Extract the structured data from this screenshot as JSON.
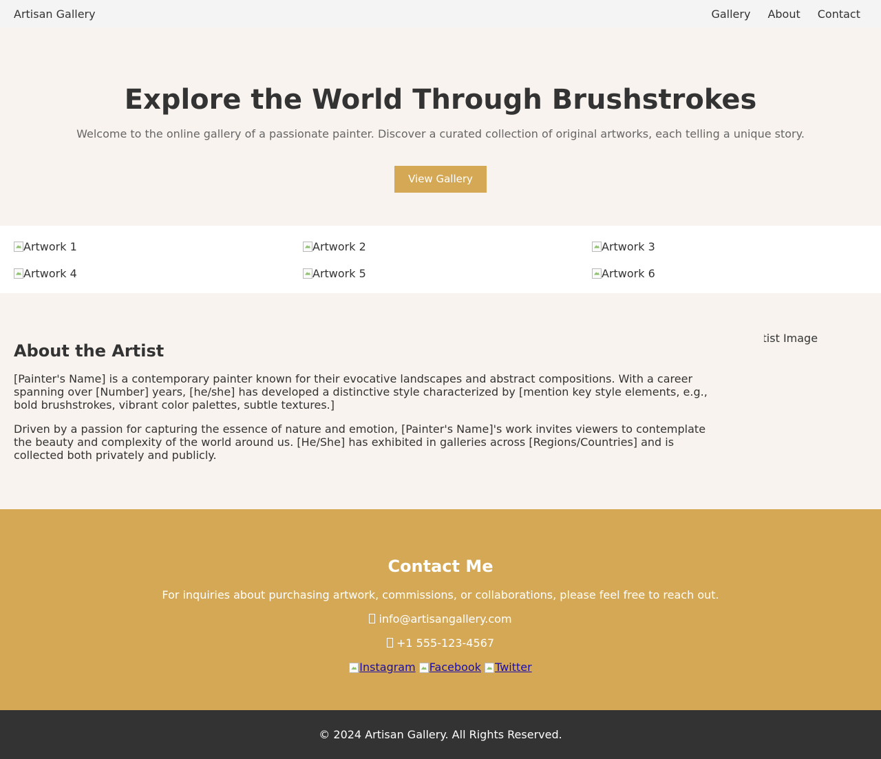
{
  "nav": {
    "brand": "Artisan Gallery",
    "links": [
      "Gallery",
      "About",
      "Contact"
    ]
  },
  "hero": {
    "title": "Explore the World Through Brushstrokes",
    "subtitle": "Welcome to the online gallery of a passionate painter. Discover a curated collection of original artworks, each telling a unique story.",
    "button_label": "View Gallery"
  },
  "gallery": {
    "items": [
      "Artwork 1",
      "Artwork 2",
      "Artwork 3",
      "Artwork 4",
      "Artwork 5",
      "Artwork 6"
    ]
  },
  "about": {
    "title": "About the Artist",
    "paragraph_1": "[Painter's Name] is a contemporary painter known for their evocative landscapes and abstract compositions. With a career spanning over [Number] years, [he/she] has developed a distinctive style characterized by [mention key style elements, e.g., bold brushstrokes, vibrant color palettes, subtle textures.]",
    "paragraph_2": "Driven by a passion for capturing the essence of nature and emotion, [Painter's Name]'s work invites viewers to contemplate the beauty and complexity of the world around us. [He/She] has exhibited in galleries across [Regions/Countries] and is collected both privately and publicly.",
    "image_alt": "Artist Image"
  },
  "contact": {
    "title": "Contact Me",
    "intro": "For inquiries about purchasing artwork, commissions, or collaborations, please feel free to reach out.",
    "email": "info@artisangallery.com",
    "phone": "+1 555-123-4567",
    "social": [
      "Instagram",
      "Facebook",
      "Twitter"
    ]
  },
  "footer": {
    "text": "© 2024 Artisan Gallery. All Rights Reserved."
  },
  "colors": {
    "accent": "#d4a855",
    "background": "#f8f3ee",
    "text": "#333333",
    "footer": "#333333"
  }
}
